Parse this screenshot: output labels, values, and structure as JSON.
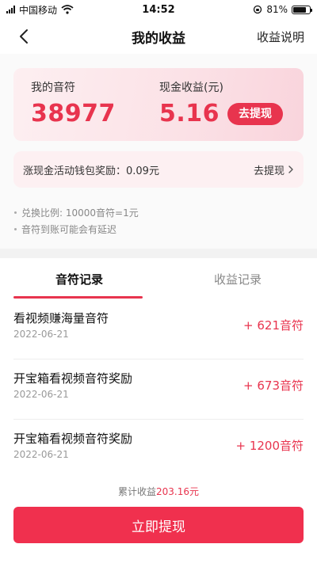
{
  "status_bar": {
    "carrier": "中国移动",
    "time": "14:52",
    "battery_text": "81%",
    "battery_level": 0.81
  },
  "nav": {
    "title": "我的收益",
    "right_link": "收益说明"
  },
  "earnings": {
    "notes_label": "我的音符",
    "notes_value": "38977",
    "cash_label": "现金收益(元)",
    "cash_value": "5.16",
    "withdraw_label": "去提现"
  },
  "wallet": {
    "text": "涨现金活动钱包奖励：0.09元",
    "link": "去提现"
  },
  "notes": [
    "兑换比例: 10000音符=1元",
    "音符到账可能会有延迟"
  ],
  "tabs": [
    {
      "label": "音符记录",
      "active": true
    },
    {
      "label": "收益记录",
      "active": false
    }
  ],
  "records": [
    {
      "title": "看视频赚海量音符",
      "date": "2022-06-21",
      "amount": "+ 621音符"
    },
    {
      "title": "开宝箱看视频音符奖励",
      "date": "2022-06-21",
      "amount": "+ 673音符"
    },
    {
      "title": "开宝箱看视频音符奖励",
      "date": "2022-06-21",
      "amount": "+ 1200音符"
    }
  ],
  "footer": {
    "total_label": "累计收益",
    "total_value": "203.16元",
    "cta_label": "立即提现"
  },
  "colors": {
    "accent": "#e8344e",
    "cta": "#f0304e"
  }
}
